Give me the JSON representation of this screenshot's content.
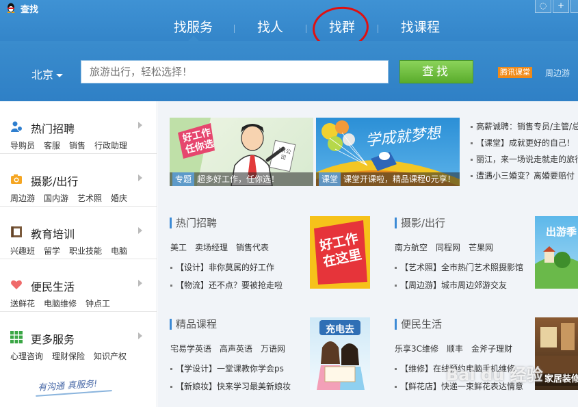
{
  "window": {
    "title": "查找"
  },
  "nav": {
    "tabs": [
      "找服务",
      "找人",
      "找群",
      "找课程"
    ]
  },
  "search": {
    "city": "北京",
    "placeholder": "旅游出行，轻松选择！",
    "button": "查找",
    "badge": "腾讯课堂",
    "around": "周边游"
  },
  "sidebar": {
    "items": [
      {
        "title": "热门招聘",
        "links": [
          "导购员",
          "客服",
          "销售",
          "行政助理"
        ]
      },
      {
        "title": "摄影/出行",
        "links": [
          "周边游",
          "国内游",
          "艺术照",
          "婚庆"
        ]
      },
      {
        "title": "教育培训",
        "links": [
          "兴趣班",
          "留学",
          "职业技能",
          "电脑"
        ]
      },
      {
        "title": "便民生活",
        "links": [
          "送鲜花",
          "电脑维修",
          "钟点工"
        ]
      },
      {
        "title": "更多服务",
        "links": [
          "心理咨询",
          "理财保险",
          "知识产权"
        ]
      }
    ],
    "slogan": "有沟通 真服务!"
  },
  "banners": [
    {
      "tag": "专题",
      "caption": "超多好工作，任你选！",
      "art_text": "好工作任你选",
      "card": "XX公司"
    },
    {
      "tag": "课堂",
      "caption": "课堂开课啦，精品课程0元享！",
      "art_text": "学成就梦想"
    }
  ],
  "news": [
    "高薪诚聘：销售专员/主管/总",
    "【课堂】成就更好的自己！",
    "丽江，来一场说走就走的旅行",
    "遭遇小三婚变？离婚要赔付"
  ],
  "sections": [
    {
      "title": "热门招聘",
      "links": [
        "美工",
        "卖场经理",
        "销售代表"
      ],
      "lines": [
        "【设计】非你莫属的好工作",
        "【物流】还不点？要被抢走啦"
      ],
      "promo": "好工作在这里"
    },
    {
      "title": "摄影/出行",
      "links": [
        "南方航空",
        "同程网",
        "芒果网"
      ],
      "lines": [
        "【艺术照】全市热门艺术照摄影馆",
        "【周边游】城市周边郊游交友"
      ],
      "promo": "出游季"
    },
    {
      "title": "精品课程",
      "links": [
        "宅易学英语",
        "高声英语",
        "万语网"
      ],
      "lines": [
        "【学设计】一堂课教你学会ps",
        "【新娘妆】快来学习最美新娘妆"
      ],
      "promo": "充电去"
    },
    {
      "title": "便民生活",
      "links": [
        "乐享3C维修",
        "顺丰",
        "金斧子理财"
      ],
      "lines": [
        "【维修】在线预约电脑手机维修",
        "【鲜花店】快递一束鲜花表达情意"
      ],
      "promo": "家居装修"
    }
  ],
  "watermark": "Bai du 经验",
  "colors": {
    "accent": "#2e7fc4",
    "search_green": "#5aac2c",
    "badge_orange": "#f08a18",
    "circle_red": "#e01010"
  }
}
